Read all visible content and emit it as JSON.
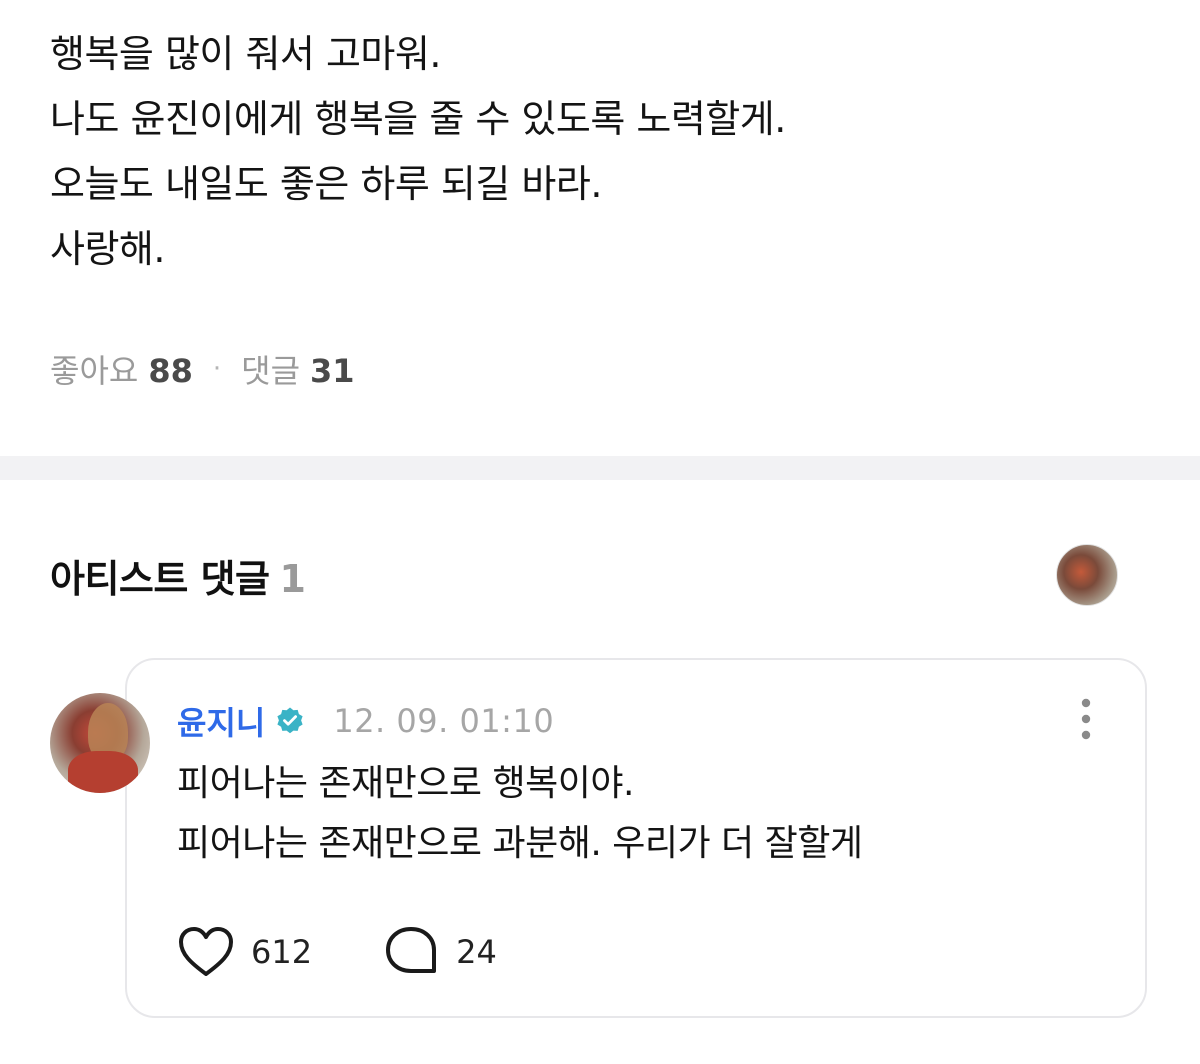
{
  "post": {
    "lines": [
      "행복을 많이 줘서 고마워.",
      "나도 윤진이에게 행복을 줄 수 있도록 노력할게.",
      "오늘도 내일도 좋은 하루 되길 바라.",
      "사랑해."
    ],
    "stats": {
      "likes_label": "좋아요",
      "likes_count": "88",
      "separator": "·",
      "comments_label": "댓글",
      "comments_count": "31"
    }
  },
  "artist_comments": {
    "title": "아티스트 댓글",
    "count": "1",
    "comment": {
      "author": "윤지니",
      "date": "12. 09. 01:10",
      "lines": [
        "피어나는 존재만으로 행복이야.",
        "피어나는 존재만으로 과분해. 우리가 더 잘할게"
      ],
      "likes": "612",
      "replies": "24"
    }
  },
  "colors": {
    "author_blue": "#2f6ae8",
    "verified_teal": "#3ab3c6",
    "muted_gray": "#9a9a9a",
    "divider": "#f2f2f4"
  },
  "icons": [
    "verified-badge-icon",
    "more-vertical-icon",
    "heart-icon",
    "comment-bubble-icon"
  ]
}
